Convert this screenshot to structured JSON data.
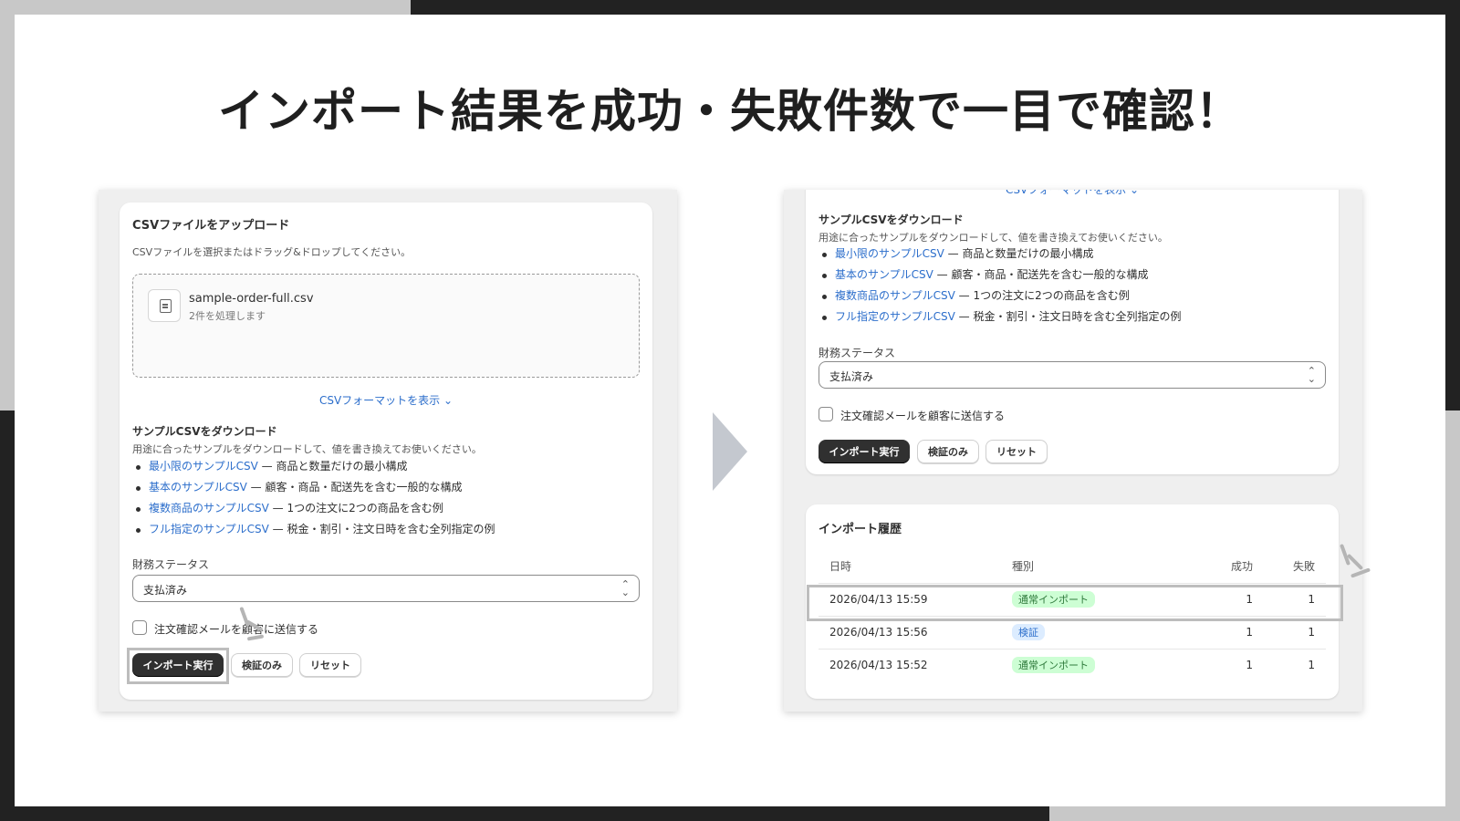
{
  "headline": "インポート結果を成功・失敗件数で一目で確認！",
  "left": {
    "upload_title": "CSVファイルをアップロード",
    "upload_desc": "CSVファイルを選択またはドラッグ&ドロップしてください。",
    "file_name": "sample-order-full.csv",
    "file_sub": "2件を処理します",
    "format_link": "CSVフォーマットを表示 ⌄",
    "sample_title": "サンプルCSVをダウンロード",
    "sample_desc": "用途に合ったサンプルをダウンロードして、値を書き換えてお使いください。",
    "samples": [
      {
        "link": "最小限のサンプルCSV",
        "desc": " — 商品と数量だけの最小構成"
      },
      {
        "link": "基本のサンプルCSV",
        "desc": " — 顧客・商品・配送先を含む一般的な構成"
      },
      {
        "link": "複数商品のサンプルCSV",
        "desc": " — 1つの注文に2つの商品を含む例"
      },
      {
        "link": "フル指定のサンプルCSV",
        "desc": " — 税金・割引・注文日時を含む全列指定の例"
      }
    ],
    "status_label": "財務ステータス",
    "status_value": "支払済み",
    "email_label": "注文確認メールを顧客に送信する",
    "btn_import": "インポート実行",
    "btn_validate": "検証のみ",
    "btn_reset": "リセット"
  },
  "right": {
    "format_link_partial": "CSVフォーマットを表示 ⌄",
    "sample_title": "サンプルCSVをダウンロード",
    "sample_desc": "用途に合ったサンプルをダウンロードして、値を書き換えてお使いください。",
    "samples": [
      {
        "link": "最小限のサンプルCSV",
        "desc": " — 商品と数量だけの最小構成"
      },
      {
        "link": "基本のサンプルCSV",
        "desc": " — 顧客・商品・配送先を含む一般的な構成"
      },
      {
        "link": "複数商品のサンプルCSV",
        "desc": " — 1つの注文に2つの商品を含む例"
      },
      {
        "link": "フル指定のサンプルCSV",
        "desc": " — 税金・割引・注文日時を含む全列指定の例"
      }
    ],
    "status_label": "財務ステータス",
    "status_value": "支払済み",
    "email_label": "注文確認メールを顧客に送信する",
    "btn_import": "インポート実行",
    "btn_validate": "検証のみ",
    "btn_reset": "リセット",
    "history_title": "インポート履歴",
    "columns": [
      "日時",
      "種別",
      "成功",
      "失敗"
    ],
    "rows": [
      {
        "date": "2026/04/13 15:59",
        "type": "通常インポート",
        "type_style": "green",
        "success": "1",
        "fail": "1"
      },
      {
        "date": "2026/04/13 15:56",
        "type": "検証",
        "type_style": "blue",
        "success": "1",
        "fail": "1"
      },
      {
        "date": "2026/04/13 15:52",
        "type": "通常インポート",
        "type_style": "green",
        "success": "1",
        "fail": "1"
      }
    ]
  },
  "colors": {
    "link": "#2c6ecb",
    "primary_button": "#303030",
    "badge_green": "#cdfed4",
    "badge_blue": "#dcecff",
    "arrow": "#c4c8cf"
  }
}
